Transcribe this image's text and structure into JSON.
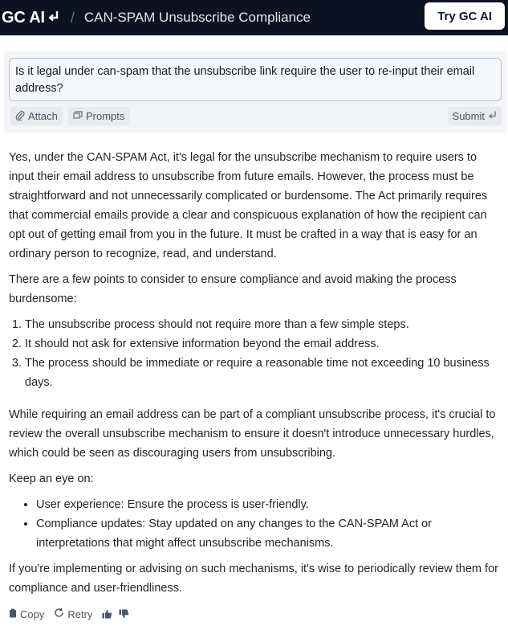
{
  "header": {
    "brand": "GC AI",
    "separator": "/",
    "title": "CAN-SPAM Unsubscribe Compliance",
    "cta_label": "Try GC AI"
  },
  "composer": {
    "prompt_text": "Is it legal under can-spam that the unsubscribe link require the user to re-input their email address?",
    "attach_label": "Attach",
    "prompts_label": "Prompts",
    "submit_label": "Submit"
  },
  "answer": {
    "p1": "Yes, under the CAN-SPAM Act, it's legal for the unsubscribe mechanism to require users to input their email address to unsubscribe from future emails. However, the process must be straightforward and not unnecessarily complicated or burdensome. The Act primarily requires that commercial emails provide a clear and conspicuous explanation of how the recipient can opt out of getting email from you in the future. It must be crafted in a way that is easy for an ordinary person to recognize, read, and understand.",
    "p2": "There are a few points to consider to ensure compliance and avoid making the process burdensome:",
    "ordered": [
      "The unsubscribe process should not require more than a few simple steps.",
      "It should not ask for extensive information beyond the email address.",
      "The process should be immediate or require a reasonable time not exceeding 10 business days."
    ],
    "p3": "While requiring an email address can be part of a compliant unsubscribe process, it's crucial to review the overall unsubscribe mechanism to ensure it doesn't introduce unnecessary hurdles, which could be seen as discouraging users from unsubscribing.",
    "p4": "Keep an eye on:",
    "bullets": [
      "User experience: Ensure the process is user-friendly.",
      "Compliance updates: Stay updated on any changes to the CAN-SPAM Act or interpretations that might affect unsubscribe mechanisms."
    ],
    "p5": "If you're implementing or advising on such mechanisms, it's wise to periodically review them for compliance and user-friendliness."
  },
  "actions": {
    "copy_label": "Copy",
    "retry_label": "Retry"
  },
  "icons": {
    "brand": "return-arrow-icon",
    "attach": "paperclip-icon",
    "prompts": "stack-icon",
    "submit": "return-arrow-icon",
    "copy": "clipboard-icon",
    "retry": "refresh-icon",
    "like": "thumbs-up-icon",
    "dislike": "thumbs-down-icon"
  }
}
